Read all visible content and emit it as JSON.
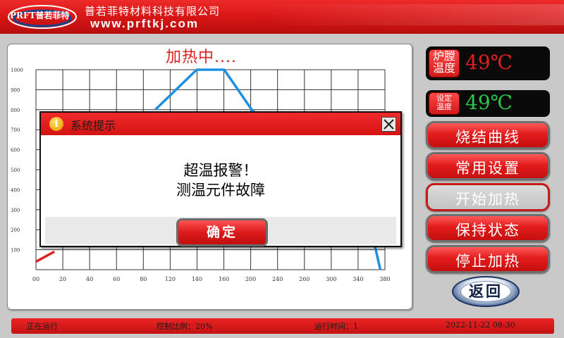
{
  "header": {
    "logo_text": "PRFT普若菲特",
    "company_name": "普若菲特材料科技有限公司",
    "website": "www.prftkj.com"
  },
  "chart": {
    "status_title": "加热中....",
    "chart_data": {
      "type": "line",
      "x_ticks": [
        "00",
        "20",
        "40",
        "60",
        "80",
        "120",
        "140",
        "160",
        "200",
        "240",
        "260",
        "300",
        "340",
        "380"
      ],
      "y_ticks": [
        "1000",
        "900",
        "800",
        "700",
        "600",
        "500",
        "400",
        "300",
        "200",
        "100"
      ],
      "ylim": [
        0,
        1000
      ],
      "grid": true,
      "series": [
        {
          "color": "#1e90e0",
          "points": [
            [
              130,
              800
            ],
            [
              175,
              1000
            ],
            [
              205,
              1000
            ],
            [
              235,
              800
            ],
            [
              360,
              300
            ],
            [
              375,
              0
            ]
          ]
        },
        {
          "color": "#e0201e",
          "points": [
            [
              0,
              40
            ],
            [
              20,
              90
            ]
          ]
        }
      ]
    }
  },
  "temperatures": {
    "furnace_label": "炉膛温度",
    "furnace_value": "49℃",
    "furnace_color": "#e0201e",
    "setpoint_label": "设定温度",
    "setpoint_value": "49℃",
    "setpoint_color": "#28c84a"
  },
  "buttons": {
    "sinter_curve": "烧结曲线",
    "common_settings": "常用设置",
    "start_heating": "开始加热",
    "hold_state": "保持状态",
    "stop_heating": "停止加热",
    "back": "返回"
  },
  "status_bar": {
    "running": "正在运行",
    "control_ratio": "控制比例：20%",
    "run_time": "运行时间：1",
    "datetime": "2022-11-22 08:30"
  },
  "dialog": {
    "title": "系统提示",
    "message_line1": "超温报警！",
    "message_line2": "测温元件故障",
    "ok_label": "确定",
    "info_glyph": "i",
    "close_glyph": "✕"
  },
  "colors": {
    "accent_red": "#d81818",
    "curve_blue": "#1e90e0"
  }
}
